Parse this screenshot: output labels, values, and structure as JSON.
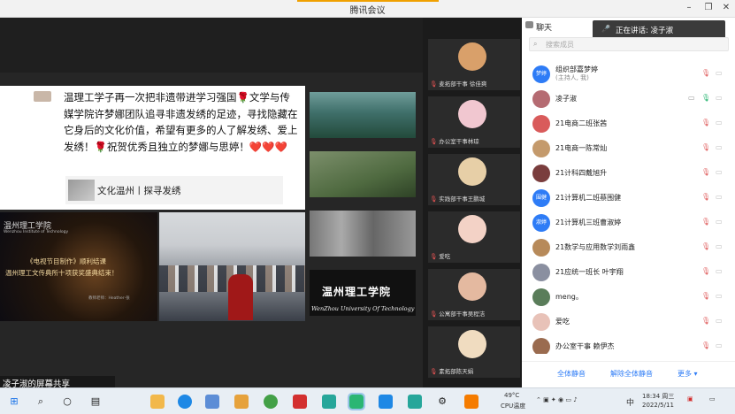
{
  "window": {
    "title": "腾讯会议"
  },
  "slide": {
    "message": "温理工学子再一次把非遗带进学习强国🌹文学与传媒学院许梦娜团队追寻非遗发绣的足迹，寻找隐藏在它身后的文化价值，希望有更多的人了解发绣、爱上发绣！🌹祝贺优秀且独立的梦娜与思婷！❤️❤️❤️",
    "card_text": "文化温州丨探寻发绣"
  },
  "poster": {
    "title_cn": "温州理工学院",
    "title_en": "Wenzhou Institute of Technology",
    "line1": "《电视节目制作》顺利结课",
    "line2": "温州理工文传典所十项获奖盛典结束！",
    "credit": "教师老师：Heather·张"
  },
  "photo_banner": {
    "cn": "温州理工学院",
    "en": "WenZhou University Of Technology"
  },
  "share_label": "凌子淑的屏幕共享",
  "tiles": [
    {
      "name": "麦拓部干事 徐佳爽",
      "color": "#d9a06a"
    },
    {
      "name": "办公室干事林琼",
      "color": "#f1c7d0"
    },
    {
      "name": "实践部干事王鹏城",
      "color": "#e7cfa7"
    },
    {
      "name": "爱吃",
      "color": "#f3d2c6"
    },
    {
      "name": "公寓部干事吴程洁",
      "color": "#e4b9a0"
    },
    {
      "name": "素拓部陈天娟",
      "color": "#f0dcc0"
    }
  ],
  "panel": {
    "tab_label": "聊天",
    "speaking_label": "正在讲话: 凌子淑",
    "search_placeholder": "搜索成员",
    "participants": [
      {
        "name": "组织部嘉梦婷",
        "sub": "(主持人, 我)",
        "avatar_text": "梦婷",
        "avatar_color": "#2e7cf6"
      },
      {
        "name": "凌子淑",
        "sub": "",
        "avatar_text": "",
        "avatar_color": "#b56b72"
      },
      {
        "name": "21电商二班张茜",
        "sub": "",
        "avatar_text": "",
        "avatar_color": "#d95b5b"
      },
      {
        "name": "21电商一陈常灿",
        "sub": "",
        "avatar_text": "",
        "avatar_color": "#c49a6c"
      },
      {
        "name": "21计科四戴旭升",
        "sub": "",
        "avatar_text": "",
        "avatar_color": "#7a3d3d"
      },
      {
        "name": "21计算机二班蔡围健",
        "sub": "",
        "avatar_text": "围健",
        "avatar_color": "#2e7cf6"
      },
      {
        "name": "21计算机三班曹淑婷",
        "sub": "",
        "avatar_text": "淑婷",
        "avatar_color": "#2e7cf6"
      },
      {
        "name": "21数学与应用数学刘雨鑫",
        "sub": "",
        "avatar_text": "",
        "avatar_color": "#b78a5a"
      },
      {
        "name": "21应统一班长 叶宇翔",
        "sub": "",
        "avatar_text": "",
        "avatar_color": "#8a8fa0"
      },
      {
        "name": "meng。",
        "sub": "",
        "avatar_text": "",
        "avatar_color": "#5a7d5a"
      },
      {
        "name": "爱吃",
        "sub": "",
        "avatar_text": "",
        "avatar_color": "#e8c2b8"
      },
      {
        "name": "办公室干事 赖伊杰",
        "sub": "",
        "avatar_text": "",
        "avatar_color": "#9a6b4f"
      }
    ],
    "footer": {
      "mute_all": "全体静音",
      "unmute_all": "解除全体静音",
      "more": "更多 ▾"
    }
  },
  "taskbar": {
    "weather_temp": "49°C",
    "weather_label": "CPU温度",
    "time": "18:34 周三",
    "date": "2022/5/11",
    "ime": "中"
  }
}
